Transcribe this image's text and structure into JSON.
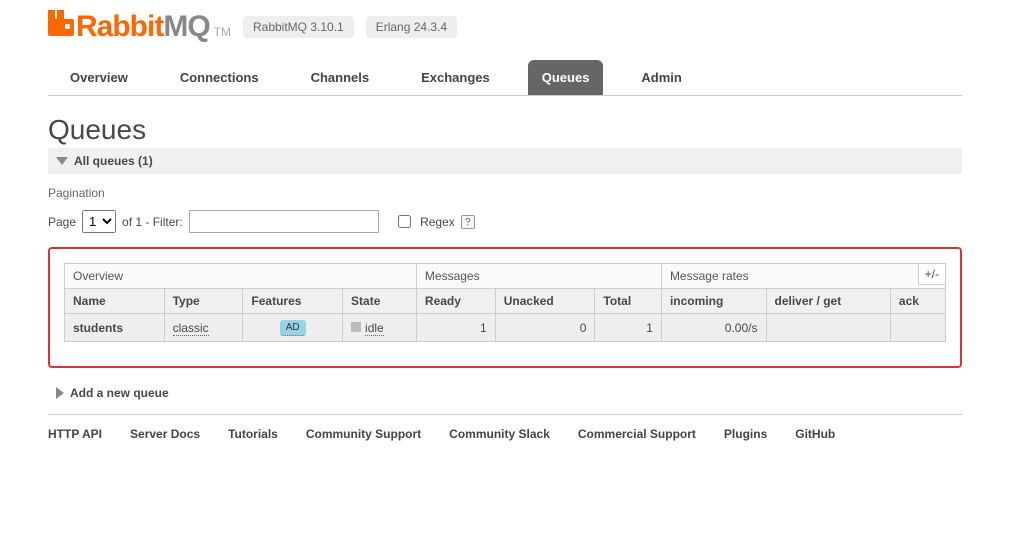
{
  "header": {
    "logo_text1": "Rabbit",
    "logo_text2": "MQ",
    "logo_tm": "TM",
    "version": "RabbitMQ 3.10.1",
    "erlang": "Erlang 24.3.4"
  },
  "tabs": [
    {
      "label": "Overview",
      "active": false
    },
    {
      "label": "Connections",
      "active": false
    },
    {
      "label": "Channels",
      "active": false
    },
    {
      "label": "Exchanges",
      "active": false
    },
    {
      "label": "Queues",
      "active": true
    },
    {
      "label": "Admin",
      "active": false
    }
  ],
  "page_title": "Queues",
  "all_queues": {
    "label": "All queues",
    "count": "(1)"
  },
  "pagination": {
    "section_label": "Pagination",
    "page_label": "Page",
    "page_value": "1",
    "of_text": "of 1  - Filter:",
    "filter_value": "",
    "regex_label": "Regex",
    "help": "?"
  },
  "table": {
    "group_headers": [
      "Overview",
      "Messages",
      "Message rates"
    ],
    "sub_headers": [
      "Name",
      "Type",
      "Features",
      "State",
      "Ready",
      "Unacked",
      "Total",
      "incoming",
      "deliver / get",
      "ack"
    ],
    "row": {
      "name": "students",
      "type": "classic",
      "feature": "AD",
      "state": "idle",
      "ready": "1",
      "unacked": "0",
      "total": "1",
      "incoming": "0.00/s",
      "deliver_get": "",
      "ack": ""
    },
    "toggle": "+/-"
  },
  "add_queue_label": "Add a new queue",
  "footer": [
    "HTTP API",
    "Server Docs",
    "Tutorials",
    "Community Support",
    "Community Slack",
    "Commercial Support",
    "Plugins",
    "GitHub"
  ]
}
